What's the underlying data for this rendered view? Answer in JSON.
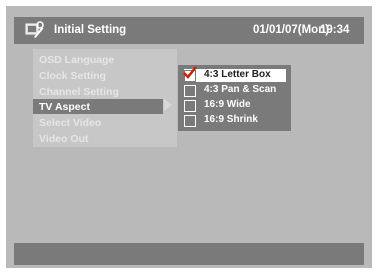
{
  "header": {
    "title": "Initial Setting",
    "date": "01/01/07(Mon)",
    "time": "19:34",
    "icon": "settings-icon"
  },
  "menu": {
    "items": [
      {
        "label": "OSD Language",
        "selected": false
      },
      {
        "label": "Clock Setting",
        "selected": false
      },
      {
        "label": "Channel Setting",
        "selected": false
      },
      {
        "label": "TV Aspect",
        "selected": true
      },
      {
        "label": "Select Video",
        "selected": false
      },
      {
        "label": "Video Out",
        "selected": false
      }
    ]
  },
  "submenu": {
    "options": [
      {
        "label": "4:3 Letter Box",
        "checked": true,
        "selected": true
      },
      {
        "label": "4:3 Pan & Scan",
        "checked": false,
        "selected": false
      },
      {
        "label": "16:9 Wide",
        "checked": false,
        "selected": false
      },
      {
        "label": "16:9 Shrink",
        "checked": false,
        "selected": false
      }
    ]
  },
  "colors": {
    "background": "#b9b9b9",
    "bar": "#7a7a7a",
    "highlight": "#ffffff",
    "check": "#cc2200"
  }
}
